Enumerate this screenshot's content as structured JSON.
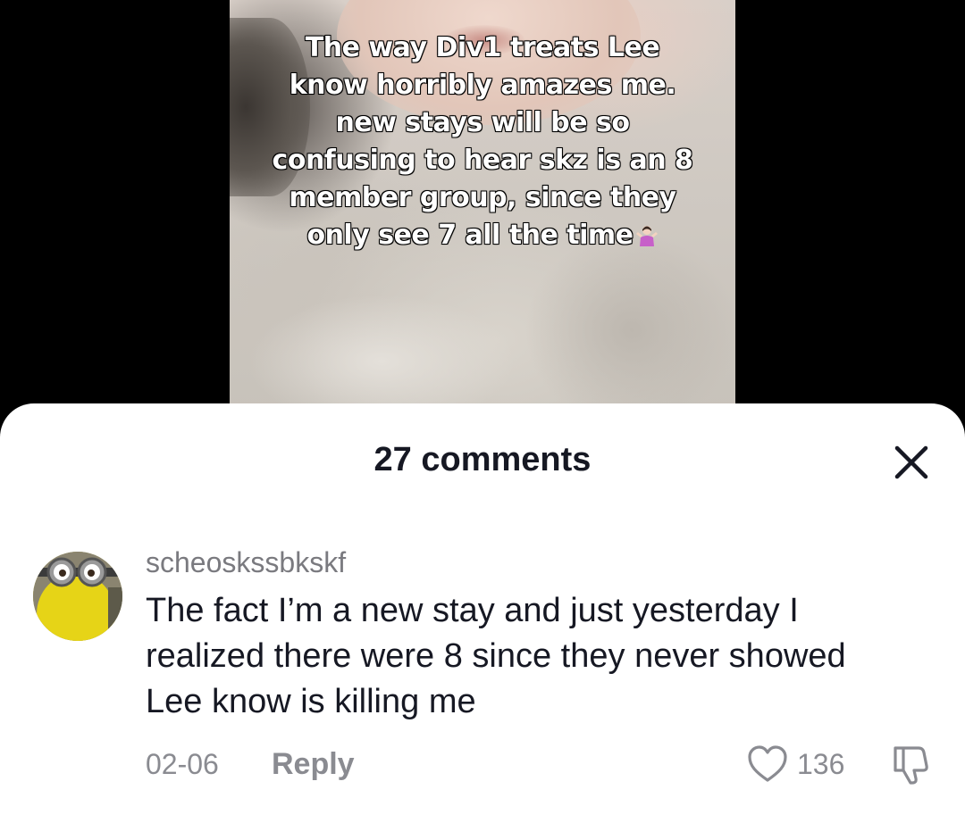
{
  "video": {
    "caption_lines": [
      "The way Div1 treats Lee",
      "know horribly amazes me.",
      "new stays will be so",
      "confusing to hear skz is an 8",
      "member group, since they",
      "only see 7 all the time"
    ],
    "caption_emoji_icon": "person-shrugging-icon"
  },
  "comments_panel": {
    "title": "27 comments",
    "close_icon": "close-icon"
  },
  "comment": {
    "username": "scheoskssbkskf",
    "text_lines": [
      "The fact I’m a new stay and just yesterday I",
      "realized there were 8 since they never showed",
      "Lee know is killing me"
    ],
    "date": "02-06",
    "reply_label": "Reply",
    "like_count": "136",
    "like_icon": "heart-outline-icon",
    "dislike_icon": "thumbs-down-icon"
  }
}
